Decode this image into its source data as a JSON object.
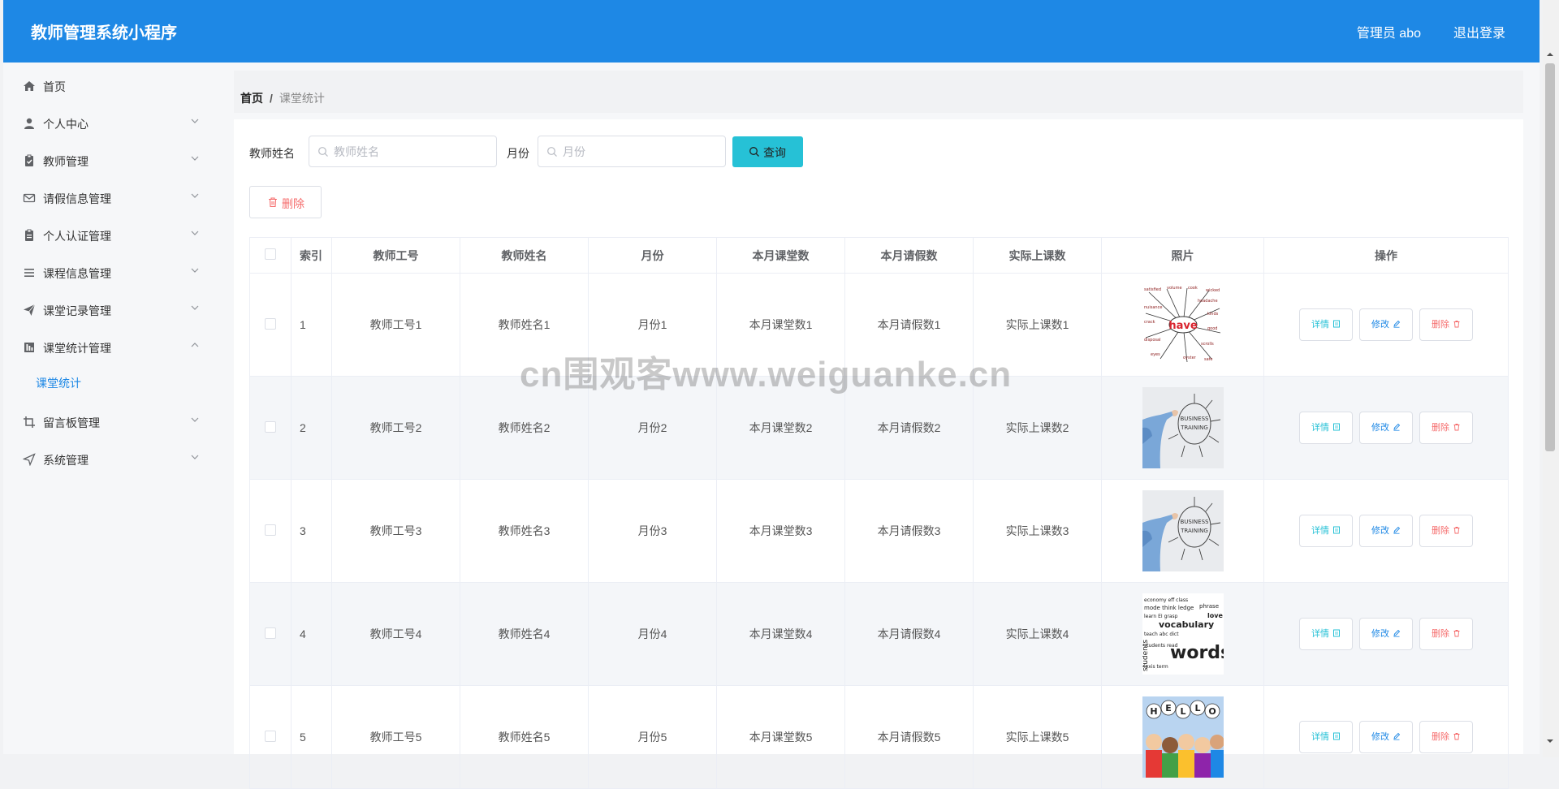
{
  "header": {
    "title": "教师管理系统小程序",
    "user": "管理员 abo",
    "logout": "退出登录"
  },
  "sidebar": {
    "items": [
      {
        "label": "首页",
        "icon": "home-icon"
      },
      {
        "label": "个人中心",
        "icon": "user-icon"
      },
      {
        "label": "教师管理",
        "icon": "clipboard-icon"
      },
      {
        "label": "请假信息管理",
        "icon": "mail-icon"
      },
      {
        "label": "个人认证管理",
        "icon": "clipboard-list-icon"
      },
      {
        "label": "课程信息管理",
        "icon": "list-icon"
      },
      {
        "label": "课堂记录管理",
        "icon": "send-icon"
      },
      {
        "label": "课堂统计管理",
        "icon": "chart-icon"
      },
      {
        "label": "留言板管理",
        "icon": "crop-icon"
      },
      {
        "label": "系统管理",
        "icon": "navigation-icon"
      }
    ],
    "sub_item": "课堂统计"
  },
  "breadcrumb": {
    "home": "首页",
    "separator": "/",
    "current": "课堂统计"
  },
  "search": {
    "teacher_label": "教师姓名",
    "teacher_placeholder": "教师姓名",
    "month_label": "月份",
    "month_placeholder": "月份",
    "query_button": "查询"
  },
  "actions": {
    "delete_button": "删除"
  },
  "table": {
    "headers": [
      "索引",
      "教师工号",
      "教师姓名",
      "月份",
      "本月课堂数",
      "本月请假数",
      "实际上课数",
      "照片",
      "操作"
    ],
    "rows": [
      {
        "index": "1",
        "teacher_no": "教师工号1",
        "teacher_name": "教师姓名1",
        "month": "月份1",
        "classes": "本月课堂数1",
        "leaves": "本月请假数1",
        "actual": "实际上课数1",
        "photo": "have-wordcloud-image"
      },
      {
        "index": "2",
        "teacher_no": "教师工号2",
        "teacher_name": "教师姓名2",
        "month": "月份2",
        "classes": "本月课堂数2",
        "leaves": "本月请假数2",
        "actual": "实际上课数2",
        "photo": "business-training-image"
      },
      {
        "index": "3",
        "teacher_no": "教师工号3",
        "teacher_name": "教师姓名3",
        "month": "月份3",
        "classes": "本月课堂数3",
        "leaves": "本月请假数3",
        "actual": "实际上课数3",
        "photo": "business-training-image"
      },
      {
        "index": "4",
        "teacher_no": "教师工号4",
        "teacher_name": "教师姓名4",
        "month": "月份4",
        "classes": "本月课堂数4",
        "leaves": "本月请假数4",
        "actual": "实际上课数4",
        "photo": "vocabulary-words-image"
      },
      {
        "index": "5",
        "teacher_no": "教师工号5",
        "teacher_name": "教师姓名5",
        "month": "月份5",
        "classes": "本月课堂数5",
        "leaves": "本月请假数5",
        "actual": "实际上课数5",
        "photo": "hello-kids-image"
      }
    ],
    "op_detail": "详情",
    "op_edit": "修改",
    "op_delete": "删除"
  },
  "watermark": "cn围观客www.weiguanke.cn",
  "colors": {
    "primary": "#1e88e5",
    "query": "#26c1d6",
    "danger": "#f56c6c"
  }
}
